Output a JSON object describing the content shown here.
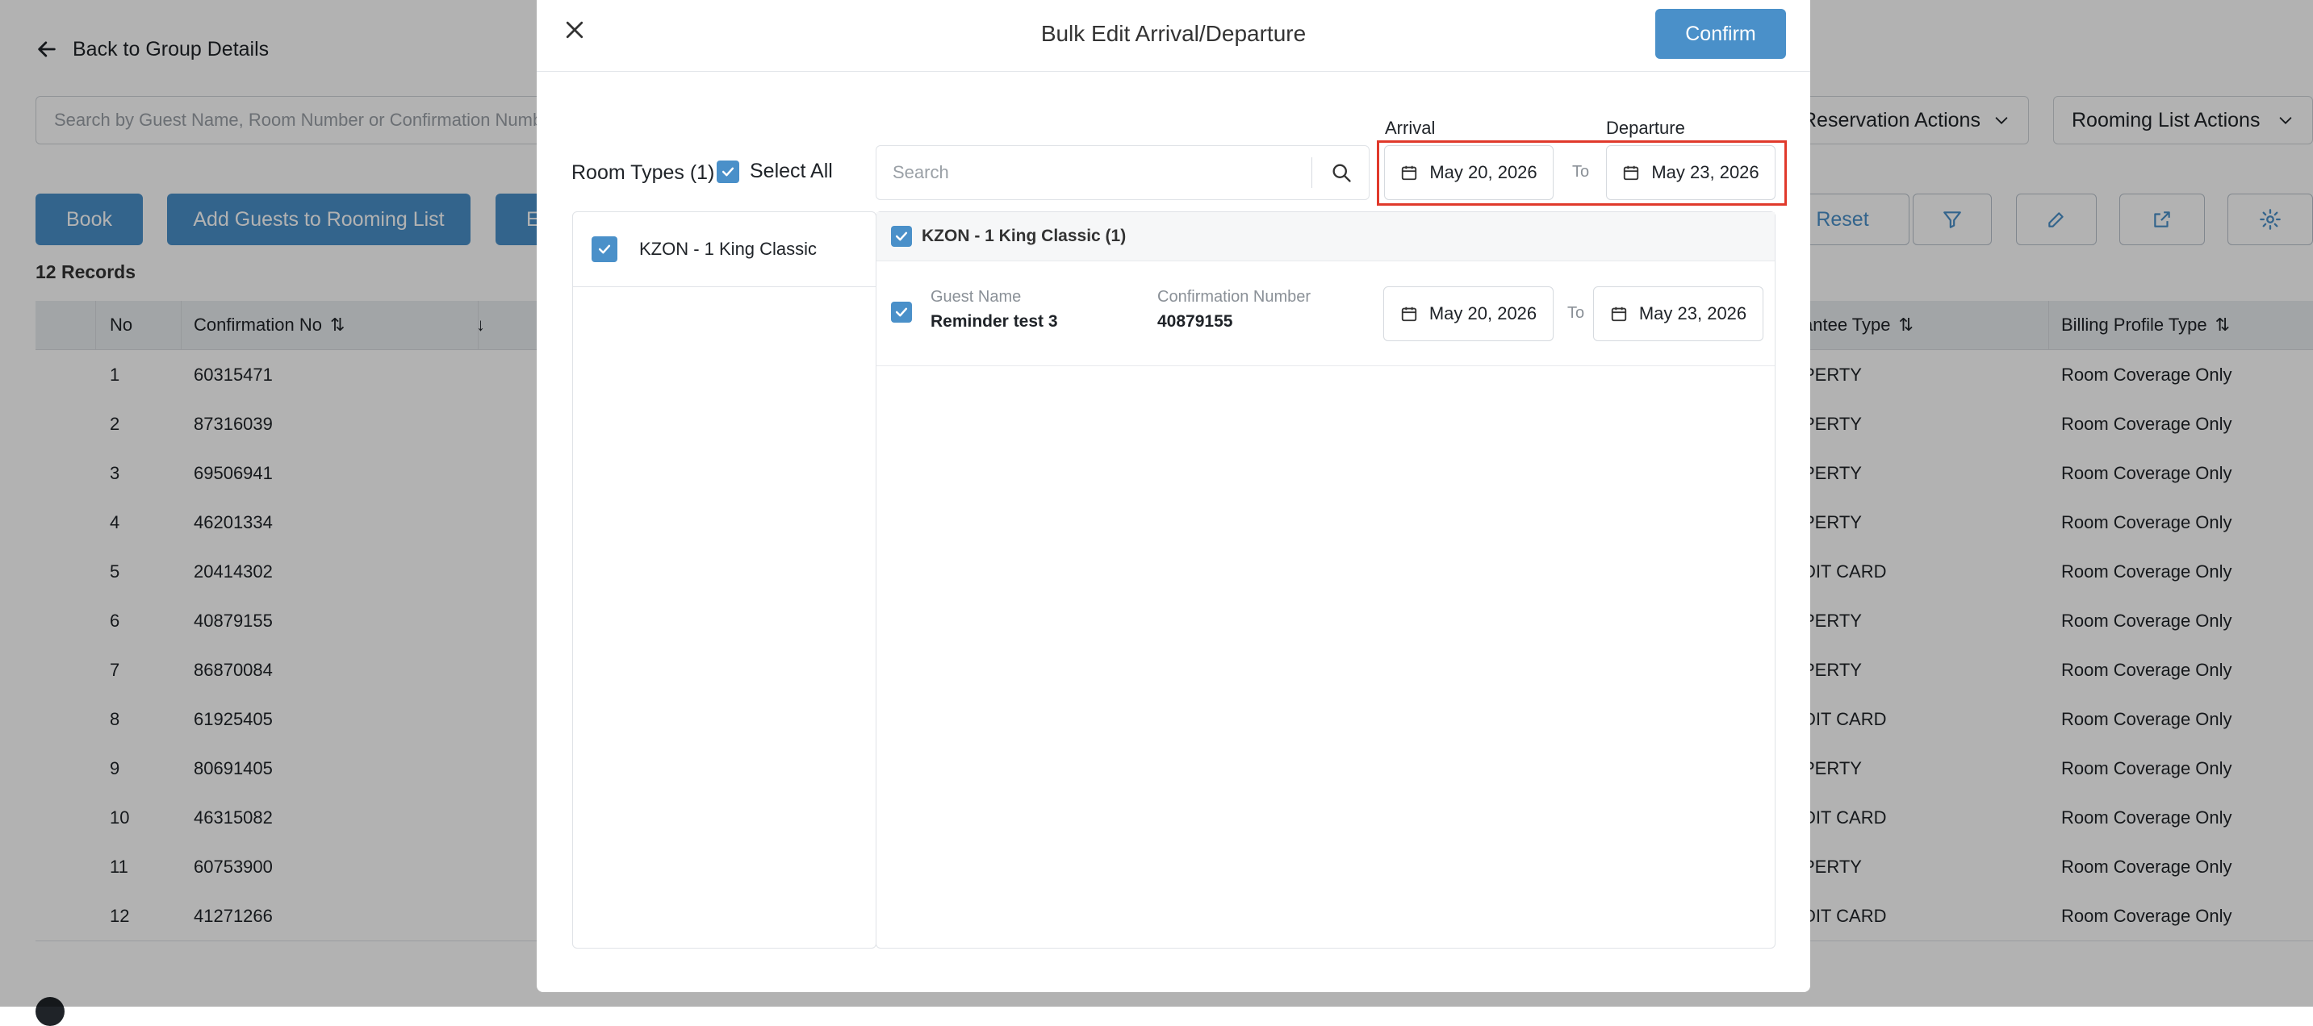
{
  "background": {
    "back_label": "Back to Group Details",
    "search_placeholder": "Search by Guest Name, Room Number or Confirmation Number",
    "reservation_actions": "Reservation Actions",
    "rooming_list_actions": "Rooming List Actions",
    "book_label": "Book",
    "add_guests_label": "Add Guests to Rooming List",
    "partial_button_label": "E",
    "reset_label": "Reset",
    "records_label": "12 Records",
    "columns": {
      "no": "No",
      "confirmation": "Confirmation No",
      "guarantee": "antee Type",
      "billing": "Billing Profile Type"
    },
    "rows": [
      {
        "no": "1",
        "conf": "60315471",
        "guarantee": "PERTY",
        "billing": "Room Coverage Only"
      },
      {
        "no": "2",
        "conf": "87316039",
        "guarantee": "PERTY",
        "billing": "Room Coverage Only"
      },
      {
        "no": "3",
        "conf": "69506941",
        "guarantee": "PERTY",
        "billing": "Room Coverage Only"
      },
      {
        "no": "4",
        "conf": "46201334",
        "guarantee": "PERTY",
        "billing": "Room Coverage Only"
      },
      {
        "no": "5",
        "conf": "20414302",
        "guarantee": "DIT CARD",
        "billing": "Room Coverage Only"
      },
      {
        "no": "6",
        "conf": "40879155",
        "guarantee": "PERTY",
        "billing": "Room Coverage Only"
      },
      {
        "no": "7",
        "conf": "86870084",
        "guarantee": "PERTY",
        "billing": "Room Coverage Only"
      },
      {
        "no": "8",
        "conf": "61925405",
        "guarantee": "DIT CARD",
        "billing": "Room Coverage Only"
      },
      {
        "no": "9",
        "conf": "80691405",
        "guarantee": "PERTY",
        "billing": "Room Coverage Only"
      },
      {
        "no": "10",
        "conf": "46315082",
        "guarantee": "DIT CARD",
        "billing": "Room Coverage Only"
      },
      {
        "no": "11",
        "conf": "60753900",
        "guarantee": "PERTY",
        "billing": "Room Coverage Only"
      },
      {
        "no": "12",
        "conf": "41271266",
        "guarantee": "DIT CARD",
        "billing": "Room Coverage Only"
      }
    ]
  },
  "modal": {
    "title": "Bulk Edit Arrival/Departure",
    "confirm_label": "Confirm",
    "room_types_label": "Room Types (1)",
    "select_all_label": "Select All",
    "search_placeholder": "Search",
    "arrival_label": "Arrival",
    "departure_label": "Departure",
    "arrival_date": "May 20, 2026",
    "departure_date": "May 23, 2026",
    "to_label": "To",
    "room_type_item": "KZON - 1 King Classic",
    "group_header": "KZON - 1 King Classic (1)",
    "guest": {
      "name_label": "Guest Name",
      "name": "Reminder test 3",
      "conf_label": "Confirmation Number",
      "conf": "40879155",
      "arrival": "May 20, 2026",
      "departure": "May 23, 2026",
      "to_label": "To"
    }
  },
  "colors": {
    "primary": "#4a90c9",
    "highlight": "#e0392b",
    "overlay": "rgba(0,0,0,0.30)"
  }
}
